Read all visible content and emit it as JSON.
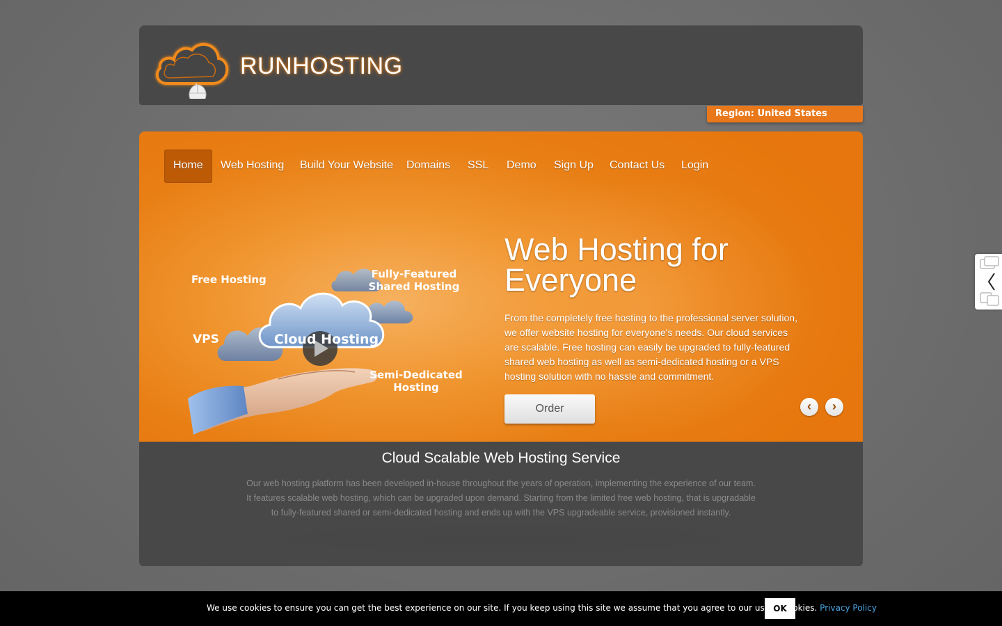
{
  "header": {
    "brand": "RUNHOSTING",
    "region": "Region: United States"
  },
  "nav": {
    "items": [
      {
        "label": "Home",
        "active": true
      },
      {
        "label": "Web Hosting"
      },
      {
        "label": "Build Your Website"
      },
      {
        "label": "Domains"
      },
      {
        "label": "SSL"
      },
      {
        "label": "Demo"
      },
      {
        "label": "Sign Up"
      },
      {
        "label": "Contact Us"
      },
      {
        "label": "Login"
      }
    ]
  },
  "hero": {
    "illustration": {
      "free_hosting": "Free Hosting",
      "fully_featured": "Fully-Featured",
      "shared_hosting": "Shared Hosting",
      "vps": "VPS",
      "cloud_hosting": "Cloud Hosting",
      "semi_dedicated": "Semi-Dedicated",
      "hosting": "Hosting"
    },
    "title": "Web Hosting for Everyone",
    "text": "From the completely free hosting to the professional server solution, we offer website hosting for everyone's needs. Our cloud services are scalable. Free hosting can easily be upgraded to fully-featured shared web hosting as well as semi-dedicated hosting or a VPS hosting solution with no hassle and commitment.",
    "order_label": "Order",
    "prev_icon": "chevron-left-icon",
    "next_icon": "chevron-right-icon"
  },
  "section": {
    "title": "Cloud Scalable Web Hosting Service",
    "text": "Our web hosting platform has been developed in-house throughout the years of operation, implementing the experience of our team. It features scalable web hosting, which can be upgraded upon demand. Starting from the limited free web hosting, that is upgradable to fully-featured shared or semi-dedicated hosting and ends up with the VPS upgradeable service, provisioned instantly."
  },
  "cookie": {
    "text": "We use cookies to ensure you can get the best experience on our site. If you keep using this site we assume that you agree to our use of cookies.",
    "link": "Privacy Policy",
    "ok": "OK"
  },
  "colors": {
    "accent": "#e87e14",
    "dark": "#484848",
    "background": "#6f6f6f"
  }
}
